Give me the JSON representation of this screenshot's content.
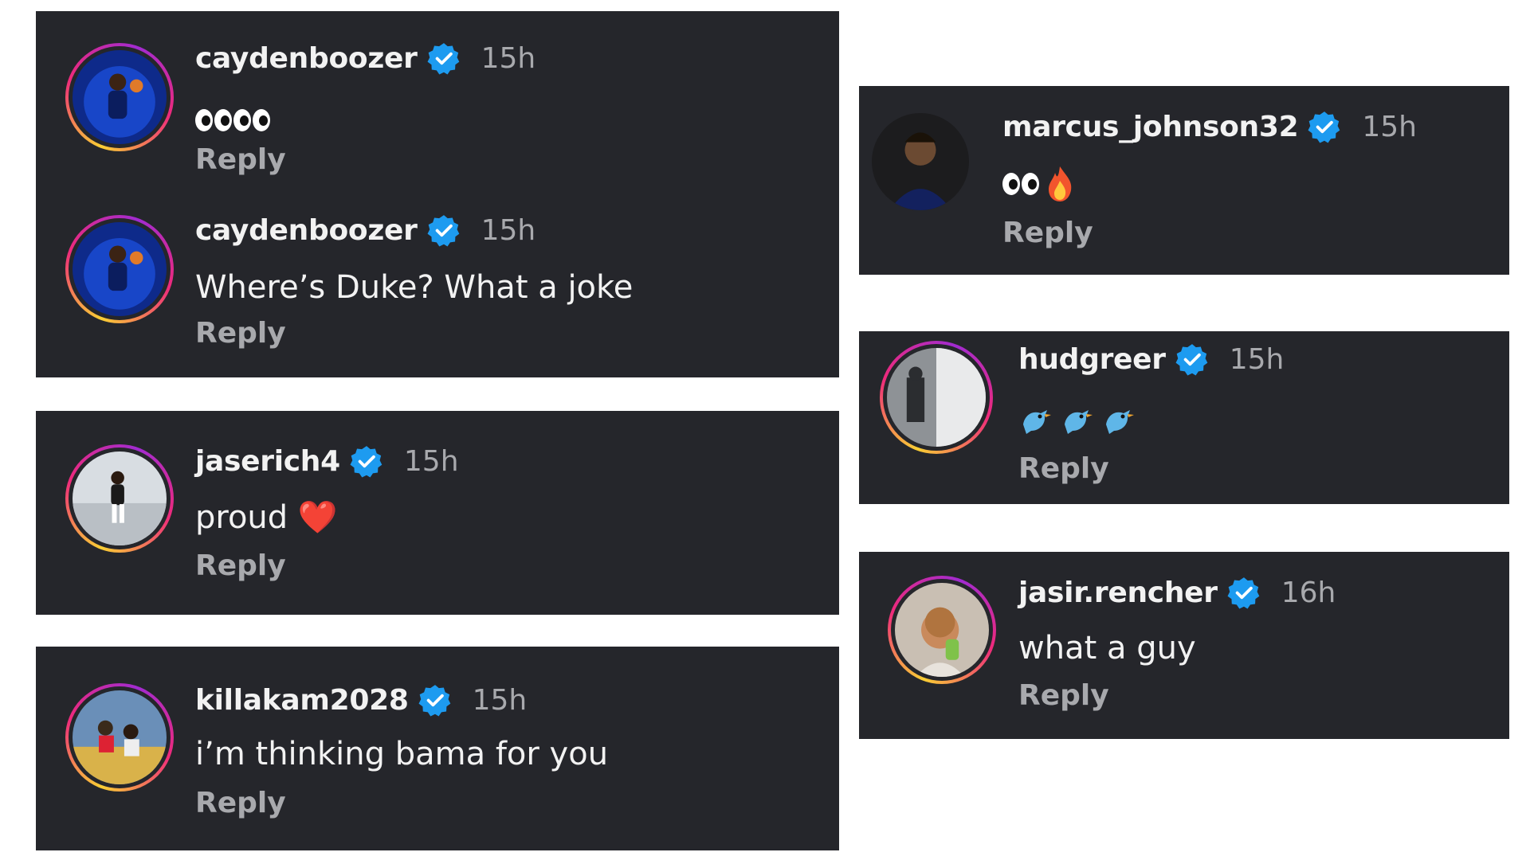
{
  "comments": [
    {
      "username": "caydenboozer",
      "time": "15h",
      "text": "",
      "emoji": "👀👀",
      "reply": "Reply"
    },
    {
      "username": "caydenboozer",
      "time": "15h",
      "text": "Where’s Duke? What a joke",
      "reply": "Reply"
    },
    {
      "username": "jaserich4",
      "time": "15h",
      "text": "proud ",
      "emoji": "❤️",
      "reply": "Reply"
    },
    {
      "username": "killakam2028",
      "time": "15h",
      "text": "i’m thinking bama for you",
      "reply": "Reply"
    },
    {
      "username": "marcus_johnson32",
      "time": "15h",
      "text": "",
      "emoji": "👀🔥",
      "reply": "Reply"
    },
    {
      "username": "hudgreer",
      "time": "15h",
      "text": "",
      "emoji": "🐦🐦🐦",
      "reply": "Reply"
    },
    {
      "username": "jasir.rencher",
      "time": "16h",
      "text": "what a guy",
      "reply": "Reply"
    }
  ],
  "colors": {
    "panel": "#25262b",
    "verified": "#1d9bf0",
    "text": "#f2f2f2",
    "muted": "#a8a9ad"
  },
  "icons": {
    "verified": "verified-badge-icon",
    "avatar": "avatar-photo"
  }
}
